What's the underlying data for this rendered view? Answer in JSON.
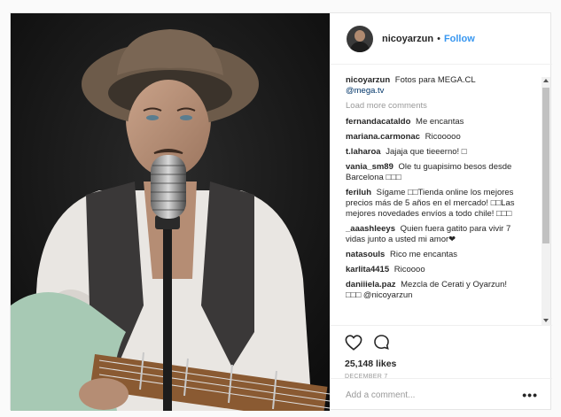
{
  "post": {
    "header": {
      "username": "nicoyarzun",
      "separator": "•",
      "follow_label": "Follow"
    },
    "caption": {
      "username": "nicoyarzun",
      "text": "Fotos para MEGA.CL",
      "mention": "@mega.tv"
    },
    "load_more_label": "Load more comments",
    "comments": [
      {
        "user": "fernandacataldo",
        "text": "Me encantas"
      },
      {
        "user": "mariana.carmonac",
        "text": "Ricooooo"
      },
      {
        "user": "t.laharoa",
        "text": "Jajaja que tieeerno! □"
      },
      {
        "user": "vania_sm89",
        "text": "Ole tu guapisimo besos desde Barcelona □□□"
      },
      {
        "user": "feriluh",
        "text": "Sígame □□Tienda online los mejores precios más de 5 años en el mercado! □□Las mejores novedades envíos a todo chile! □□□"
      },
      {
        "user": "_aaashleeys",
        "text": "Quien fuera gatito para vivir 7 vidas junto a usted mi amor❤"
      },
      {
        "user": "natasouls",
        "text": "Rico me encantas"
      },
      {
        "user": "karlita4415",
        "text": "Ricoooo"
      },
      {
        "user": "daniiiela.paz",
        "text": "Mezcla de Cerati y Oyarzun! □□□ @nicoyarzun"
      }
    ],
    "likes": "25,148 likes",
    "date": "DECEMBER 7",
    "add_comment_placeholder": "Add a comment...",
    "more_options_label": "•••",
    "icons": {
      "like": "heart-icon",
      "comment": "comment-bubble-icon"
    }
  }
}
